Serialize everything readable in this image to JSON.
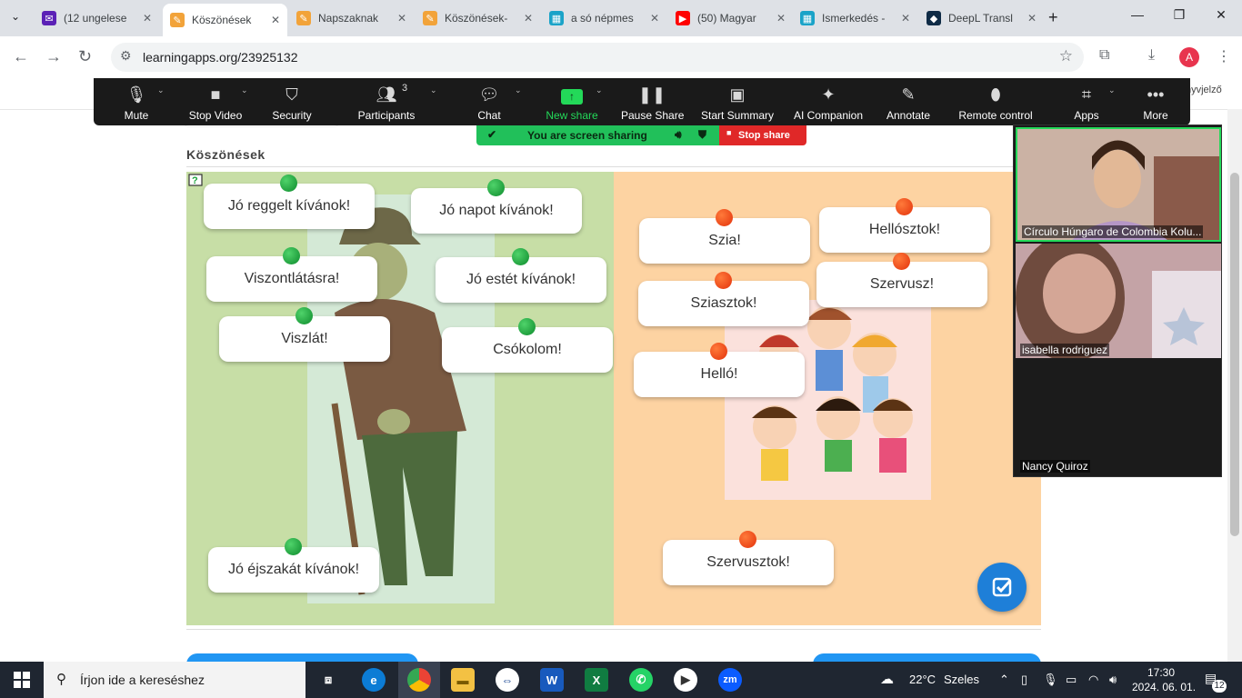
{
  "browser": {
    "tabs": [
      {
        "label": "(12 ungelese",
        "icon": "mail-icon",
        "color": "#5b21b6"
      },
      {
        "label": "Köszönések",
        "icon": "learningapps-icon",
        "color": "#f2a33a"
      },
      {
        "label": "Napszaknak",
        "icon": "learningapps-icon",
        "color": "#f2a33a"
      },
      {
        "label": "Köszönések-",
        "icon": "learningapps-icon",
        "color": "#f2a33a"
      },
      {
        "label": "a só népmes",
        "icon": "grid-icon",
        "color": "#1aa3c8"
      },
      {
        "label": "(50) Magyar",
        "icon": "youtube-icon",
        "color": "#ff0000"
      },
      {
        "label": "Ismerkedés -",
        "icon": "grid-icon",
        "color": "#1aa3c8"
      },
      {
        "label": "DeepL Transl",
        "icon": "deepl-icon",
        "color": "#0f2b46"
      }
    ],
    "url": "learningapps.org/23925132",
    "profile_initial": "A"
  },
  "zoom": {
    "toolbar": [
      {
        "label": "Mute",
        "icon": "microphone-icon"
      },
      {
        "label": "Stop Video",
        "icon": "video-camera-icon"
      },
      {
        "label": "Security",
        "icon": "shield-icon"
      },
      {
        "label": "Participants",
        "icon": "participants-icon",
        "count": "3"
      },
      {
        "label": "Chat",
        "icon": "chat-icon"
      },
      {
        "label": "New share",
        "icon": "share-arrow-icon"
      },
      {
        "label": "Pause Share",
        "icon": "pause-icon"
      },
      {
        "label": "Start Summary",
        "icon": "summary-icon"
      },
      {
        "label": "AI Companion",
        "icon": "sparkle-icon"
      },
      {
        "label": "Annotate",
        "icon": "pencil-icon"
      },
      {
        "label": "Remote control",
        "icon": "mouse-icon"
      },
      {
        "label": "Apps",
        "icon": "apps-icon"
      },
      {
        "label": "More",
        "icon": "more-dots-icon"
      }
    ],
    "sharing_status": "You are screen sharing",
    "stop_share": "Stop share",
    "partial_right_text": "nyvjelző",
    "participants_video": [
      {
        "name": "Círculo Húngaro de Colombia Kolu..."
      },
      {
        "name": "isabella rodriguez"
      },
      {
        "name": "Nancy Quiroz"
      }
    ]
  },
  "app": {
    "title": "Köszönések",
    "left_cards": [
      {
        "text": "Jó reggelt kívánok!"
      },
      {
        "text": "Jó napot kívánok!"
      },
      {
        "text": "Viszontlátásra!"
      },
      {
        "text": "Jó estét kívánok!"
      },
      {
        "text": "Viszlát!"
      },
      {
        "text": "Csókolom!"
      },
      {
        "text": "Jó éjszakát kívánok!"
      }
    ],
    "right_cards": [
      {
        "text": "Szia!"
      },
      {
        "text": "Hellósztok!"
      },
      {
        "text": "Sziasztok!"
      },
      {
        "text": "Szervusz!"
      },
      {
        "text": "Helló!"
      },
      {
        "text": "Szervusztok!"
      }
    ],
    "colors": {
      "left_zone": "#c7dea6",
      "right_zone": "#fdd3a2",
      "pin_green": "#1aa33a",
      "pin_red": "#f04a10",
      "check_button": "#1e7fd8"
    }
  },
  "taskbar": {
    "search_placeholder": "Írjon ide a kereséshez",
    "weather_temp": "22°C",
    "weather_label": "Szeles",
    "time": "17:30",
    "date": "2024. 06. 01.",
    "notification_count": "12"
  }
}
